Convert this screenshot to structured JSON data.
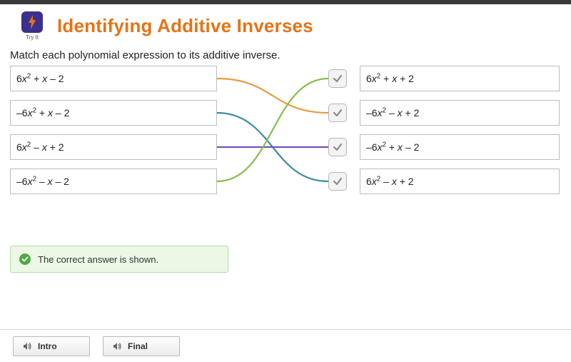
{
  "header": {
    "badge_label": "Try It",
    "title": "Identifying Additive Inverses"
  },
  "instruction": "Match each polynomial expression to its additive inverse.",
  "left_expressions": [
    "6x² + x – 2",
    "–6x² + x – 2",
    "6x² – x + 2",
    "–6x² – x – 2"
  ],
  "right_expressions": [
    "6x² + x + 2",
    "–6x² – x + 2",
    "–6x² + x – 2",
    "6x² – x + 2"
  ],
  "connections": [
    {
      "from": 0,
      "to": 1,
      "color": "#e89b3d"
    },
    {
      "from": 1,
      "to": 3,
      "color": "#3a8f9a"
    },
    {
      "from": 2,
      "to": 2,
      "color": "#7a4fb5"
    },
    {
      "from": 3,
      "to": 0,
      "color": "#86bf4a"
    }
  ],
  "feedback": "The correct answer is shown.",
  "buttons": {
    "intro": "Intro",
    "final": "Final"
  }
}
